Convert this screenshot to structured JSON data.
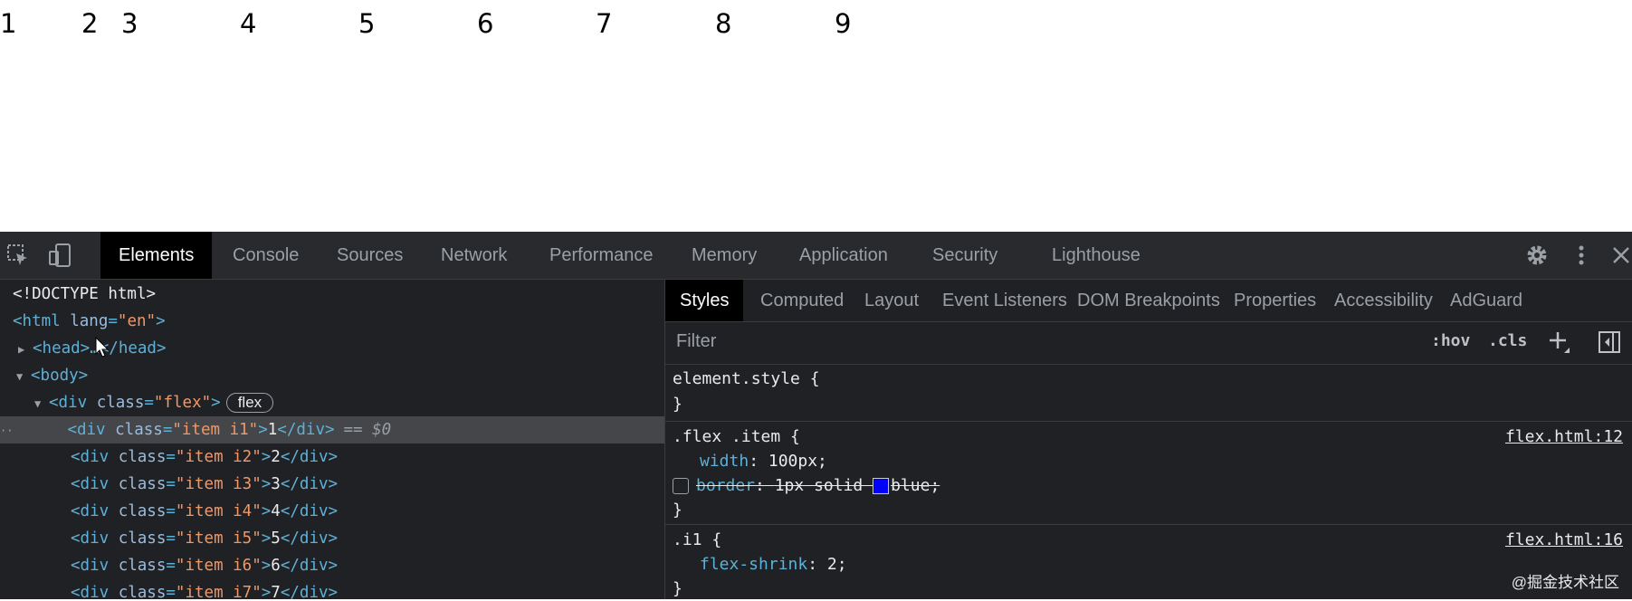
{
  "preview": {
    "items": [
      "1",
      "2",
      "3",
      "4",
      "5",
      "6",
      "7",
      "8",
      "9"
    ]
  },
  "toolbar": {
    "tabs": [
      "Elements",
      "Console",
      "Sources",
      "Network",
      "Performance",
      "Memory",
      "Application",
      "Security",
      "Lighthouse"
    ],
    "active_tab": "Elements"
  },
  "elements": {
    "doctype": "<!DOCTYPE html>",
    "html_tag_open": "<html ",
    "html_attr": "lang",
    "html_eq": "=",
    "html_val": "\"en\"",
    "html_close": ">",
    "head": "<head>…</head>",
    "body": "<body>",
    "flex_open": "<div ",
    "flex_attr": "class",
    "flex_val": "\"flex\"",
    "flex_close": ">",
    "flex_badge": "flex",
    "selected_suffix": "== $0",
    "items": [
      {
        "open": "<div ",
        "attr": "class",
        "val": "\"item i1\"",
        "text": "1",
        "close": "</div>"
      },
      {
        "open": "<div ",
        "attr": "class",
        "val": "\"item i2\"",
        "text": "2",
        "close": "</div>"
      },
      {
        "open": "<div ",
        "attr": "class",
        "val": "\"item i3\"",
        "text": "3",
        "close": "</div>"
      },
      {
        "open": "<div ",
        "attr": "class",
        "val": "\"item i4\"",
        "text": "4",
        "close": "</div>"
      },
      {
        "open": "<div ",
        "attr": "class",
        "val": "\"item i5\"",
        "text": "5",
        "close": "</div>"
      },
      {
        "open": "<div ",
        "attr": "class",
        "val": "\"item i6\"",
        "text": "6",
        "close": "</div>"
      },
      {
        "open": "<div ",
        "attr": "class",
        "val": "\"item i7\"",
        "text": "7",
        "close": "</div>"
      }
    ]
  },
  "styles": {
    "tabs": [
      "Styles",
      "Computed",
      "Layout",
      "Event Listeners",
      "DOM Breakpoints",
      "Properties",
      "Accessibility",
      "AdGuard"
    ],
    "active_tab": "Styles",
    "filter_placeholder": "Filter",
    "hov": ":hov",
    "cls": ".cls",
    "rule1": {
      "selector": "element.style {",
      "close": "}"
    },
    "rule2": {
      "selector": ".flex .item {",
      "source": "flex.html:12",
      "p1_name": "width",
      "p1_value": "100px;",
      "p2_name": "border",
      "p2_value_a": "1px solid ",
      "p2_value_b": "blue;",
      "close": "}"
    },
    "rule3": {
      "selector": ".i1 {",
      "source": "flex.html:16",
      "p1_name": "flex-shrink",
      "p1_value": "2;",
      "close": "}"
    },
    "watermark": "@掘金技术社区",
    "swatch_color": "#0000ff"
  }
}
